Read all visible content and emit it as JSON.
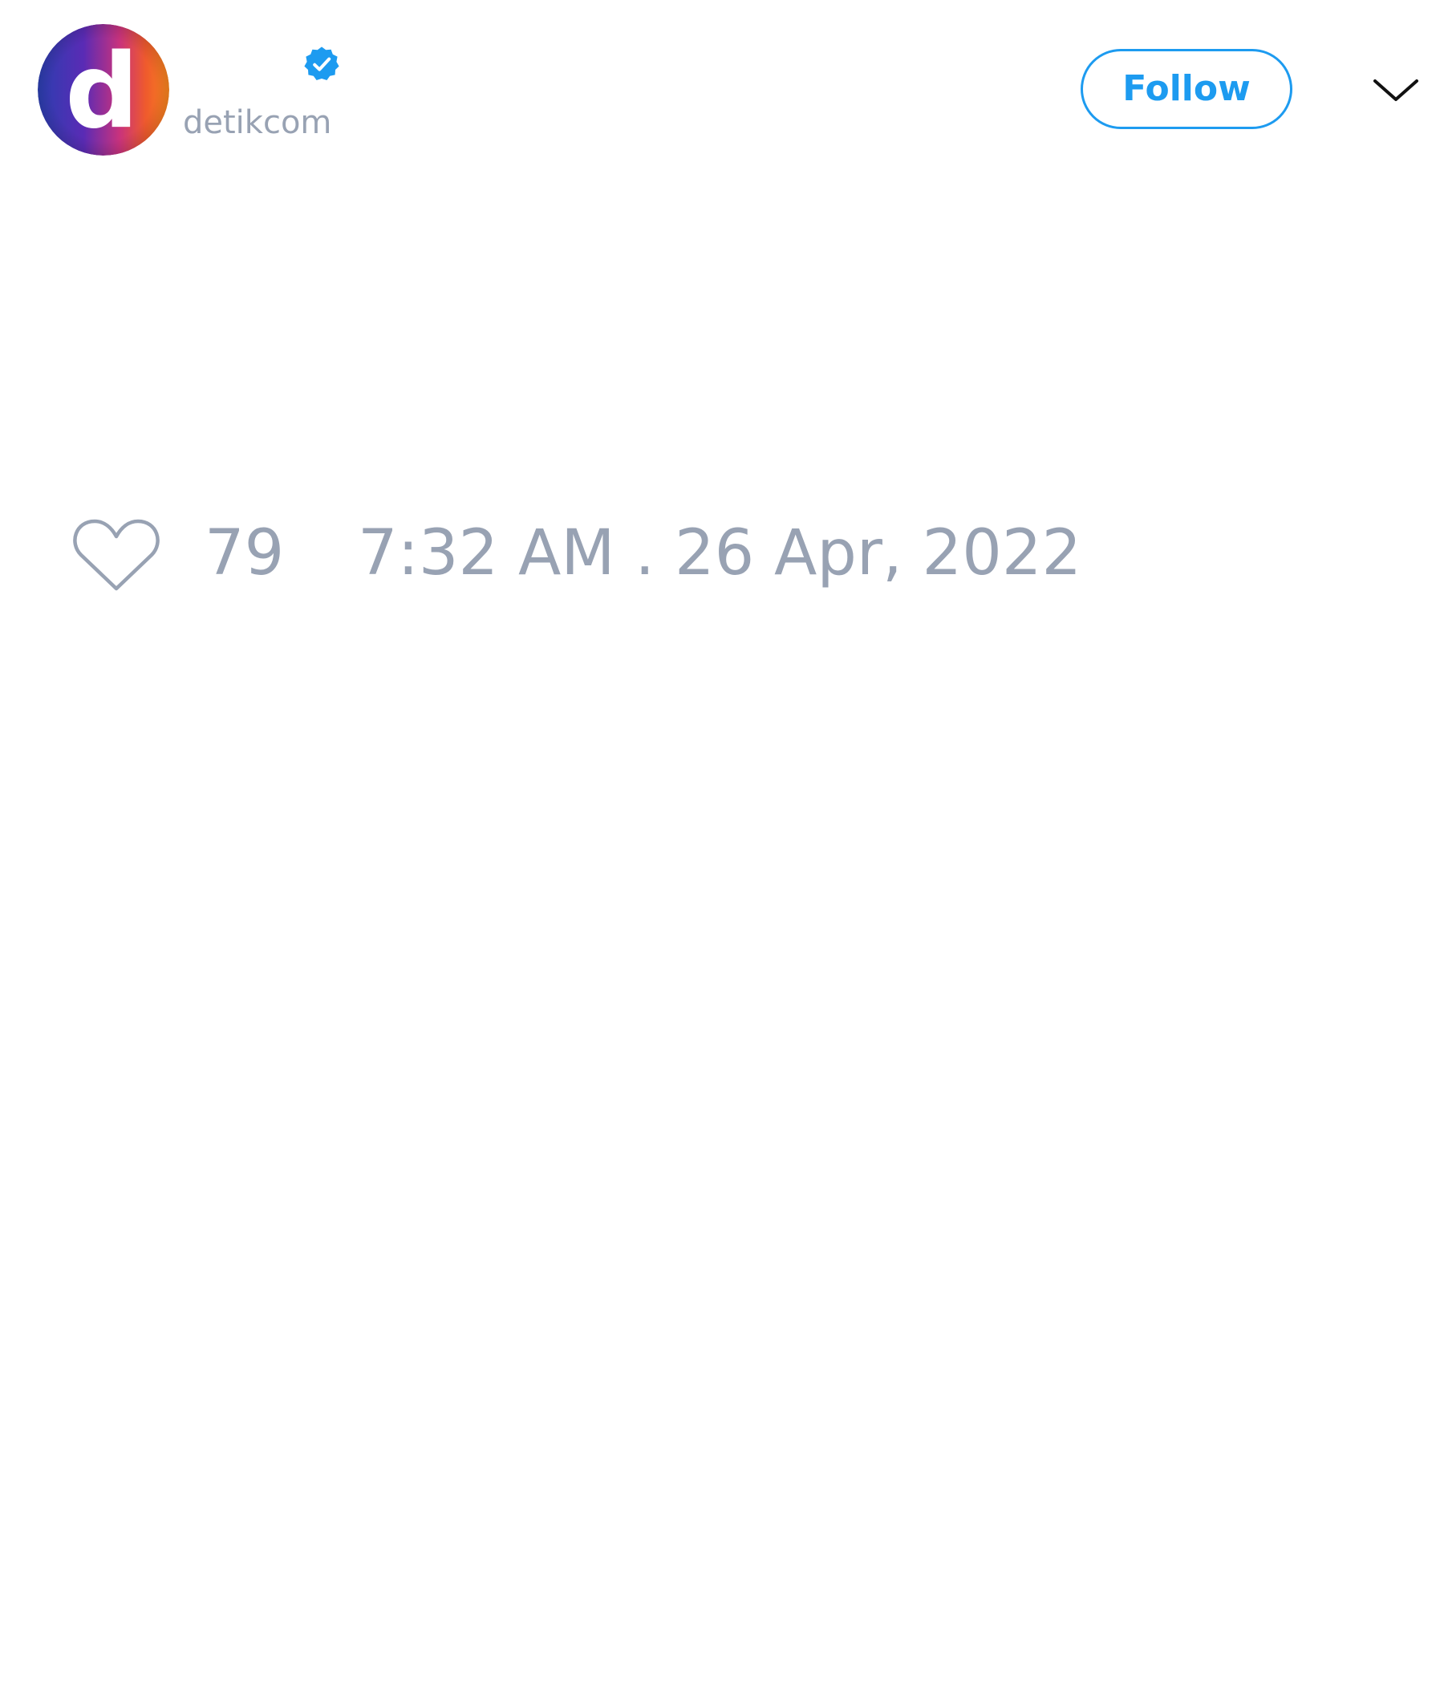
{
  "account": {
    "handle": "detikcom",
    "verified": true,
    "avatar_letter": "d"
  },
  "actions": {
    "follow_label": "Follow"
  },
  "tweet": {
    "like_count": "79",
    "timestamp": "7:32 AM . 26 Apr, 2022"
  },
  "icons": {
    "verified": "verified-badge-icon",
    "more": "chevron-down-icon",
    "like": "heart-icon"
  },
  "colors": {
    "accent": "#1d9bf0",
    "muted_text": "#98a2b3",
    "background": "#ffffff"
  }
}
